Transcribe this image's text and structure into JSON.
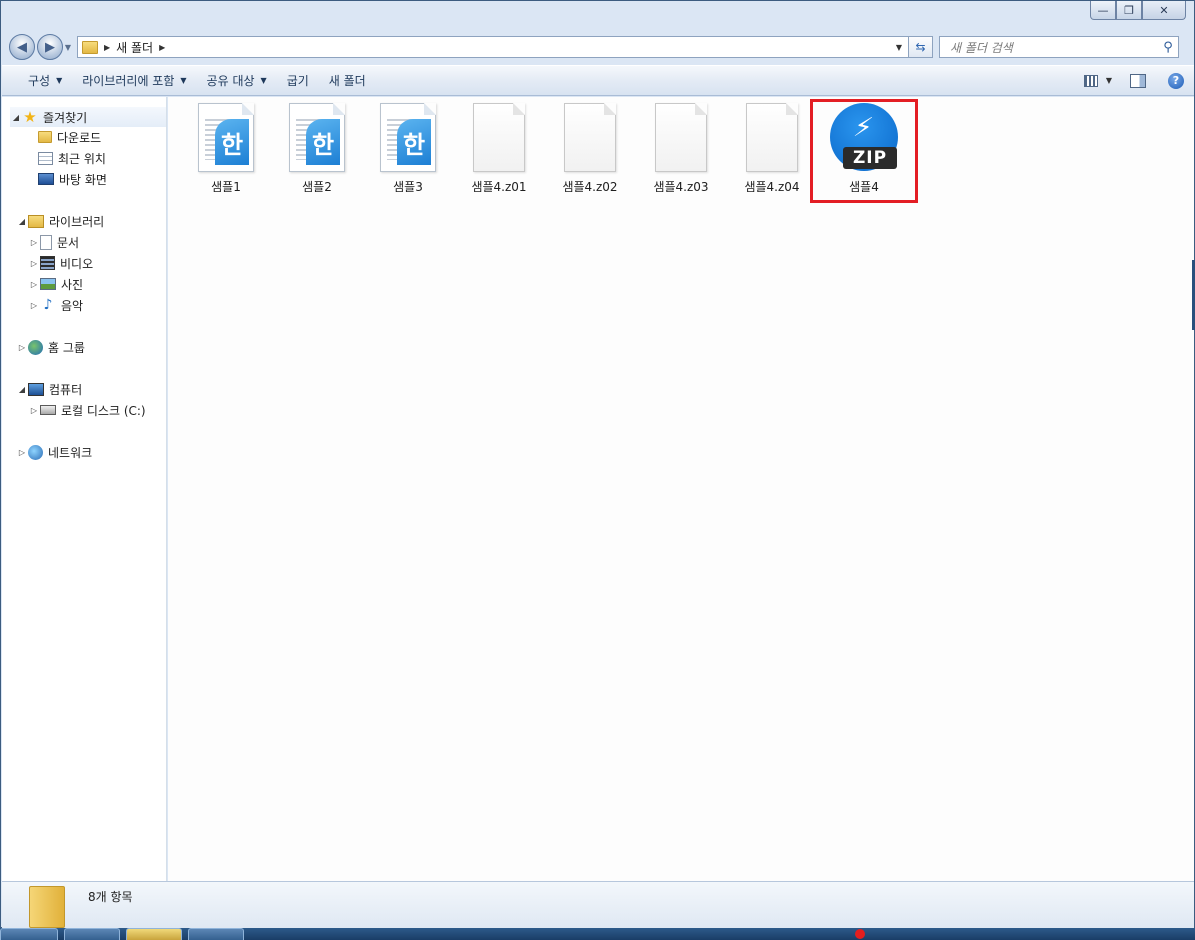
{
  "address": {
    "breadcrumb": [
      "새 폴더"
    ],
    "search_placeholder": "새 폴더 검색"
  },
  "toolbar": {
    "items": [
      {
        "label": "구성",
        "dropdown": true
      },
      {
        "label": "라이브러리에 포함",
        "dropdown": true
      },
      {
        "label": "공유 대상",
        "dropdown": true
      },
      {
        "label": "굽기",
        "dropdown": false
      },
      {
        "label": "새 폴더",
        "dropdown": false
      }
    ],
    "right_icons": [
      "view-options-icon",
      "preview-pane-icon",
      "help-icon"
    ]
  },
  "sidebar": {
    "favorites": {
      "label": "즐겨찾기",
      "items": [
        {
          "label": "다운로드",
          "icon": "download-folder-icon"
        },
        {
          "label": "최근 위치",
          "icon": "recent-places-icon"
        },
        {
          "label": "바탕 화면",
          "icon": "desktop-icon"
        }
      ]
    },
    "libraries": {
      "label": "라이브러리",
      "items": [
        {
          "label": "문서",
          "icon": "documents-icon"
        },
        {
          "label": "비디오",
          "icon": "video-icon"
        },
        {
          "label": "사진",
          "icon": "pictures-icon"
        },
        {
          "label": "음악",
          "icon": "music-icon"
        }
      ]
    },
    "homegroup": {
      "label": "홈 그룹"
    },
    "computer": {
      "label": "컴퓨터",
      "items": [
        {
          "label": "로컬 디스크 (C:)",
          "icon": "local-disk-icon"
        }
      ]
    },
    "network": {
      "label": "네트워크"
    }
  },
  "files": [
    {
      "name": "샘플1",
      "type": "hwp",
      "badge": "한"
    },
    {
      "name": "샘플2",
      "type": "hwp",
      "badge": "한"
    },
    {
      "name": "샘플3",
      "type": "hwp",
      "badge": "한"
    },
    {
      "name": "샘플4.z01",
      "type": "blank"
    },
    {
      "name": "샘플4.z02",
      "type": "blank"
    },
    {
      "name": "샘플4.z03",
      "type": "blank"
    },
    {
      "name": "샘플4.z04",
      "type": "blank"
    },
    {
      "name": "샘플4",
      "type": "zip",
      "badge": "ZIP",
      "highlighted": true
    }
  ],
  "details": {
    "item_count": "8개 항목"
  },
  "colors": {
    "highlight": "#e31e24",
    "zip_blue": "#0a67c9",
    "hwp_blue": "#1d7fd4"
  }
}
